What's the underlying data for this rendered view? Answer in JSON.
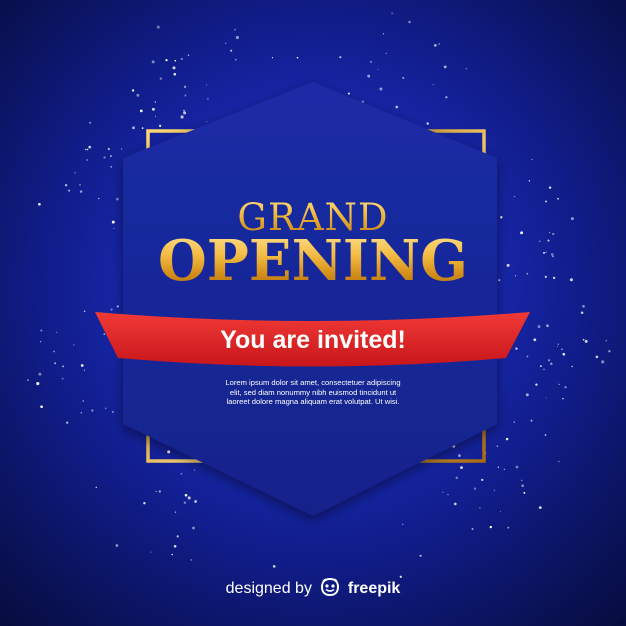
{
  "poster": {
    "headline_top": "GRAND",
    "headline_main": "OPENING",
    "ribbon_text": "You are invited!",
    "body_text": "Lorem ipsum dolor sit amet, consectetuer adipiscing elit, sed diam nonummy nibh euismod tincidunt ut laoreet dolore magna aliquam erat volutpat. Ut wisi.",
    "body_lines": [
      "Lorem ipsum dolor sit amet, consectetuer adipiscing",
      "elit, sed diam nonummy nibh euismod tincidunt ut",
      "laoreet dolore magna aliquam erat volutpat. Ut wisi."
    ]
  },
  "footer": {
    "designed_by": "designed by",
    "brand": "freepik",
    "logo_icon": "freepik-logo-icon"
  },
  "colors": {
    "background": "#1a2ab8",
    "hexagon": "#162a9a",
    "gold": "#f0b63a",
    "ribbon": "#e1262a",
    "text_white": "#ffffff"
  }
}
